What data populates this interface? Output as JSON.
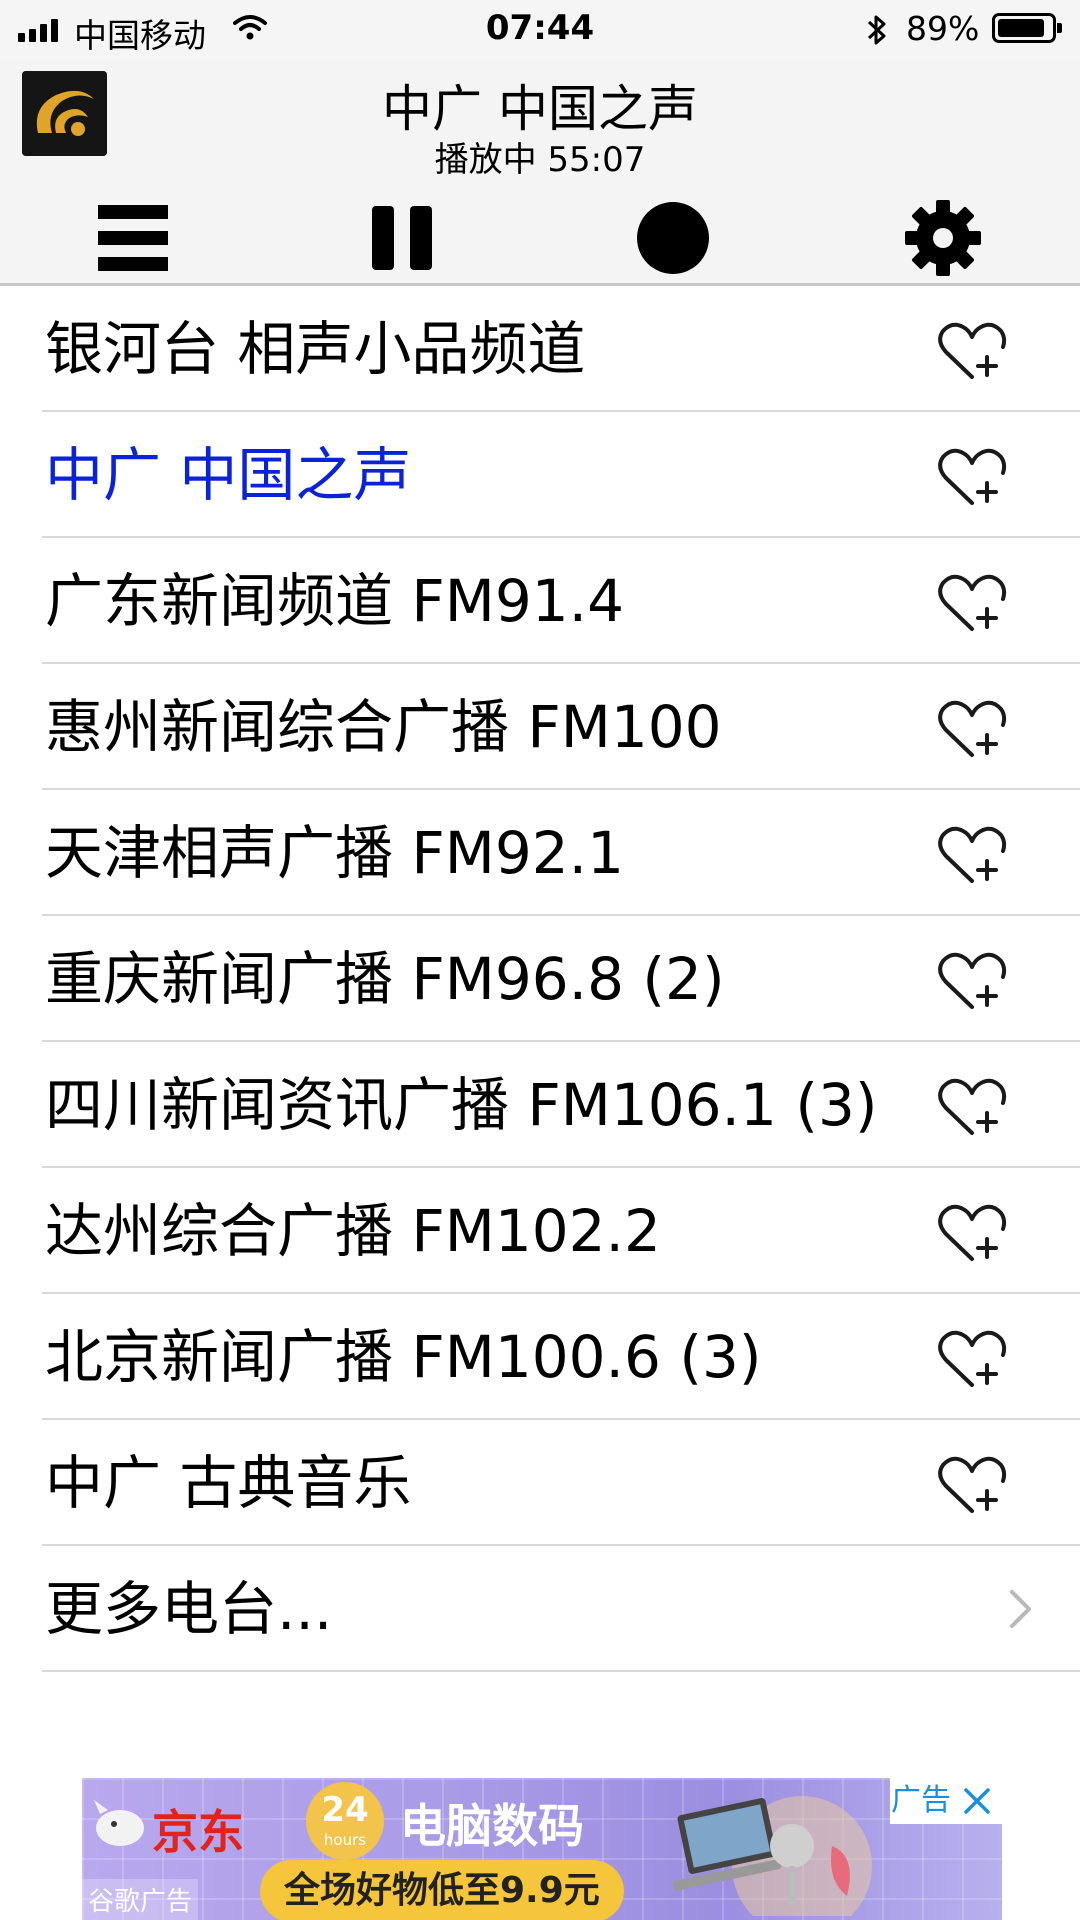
{
  "status_bar": {
    "carrier": "中国移动",
    "time": "07:44",
    "battery_percent": "89%",
    "battery_level": 0.89
  },
  "now_playing": {
    "title": "中广 中国之声",
    "status": "播放中 55:07"
  },
  "controls": [
    "menu-icon",
    "pause-icon",
    "record-icon",
    "gear-icon"
  ],
  "stations": [
    {
      "name": "银河台 相声小品频道",
      "active": false
    },
    {
      "name": "中广 中国之声",
      "active": true
    },
    {
      "name": "广东新闻频道 FM91.4",
      "active": false
    },
    {
      "name": "惠州新闻综合广播 FM100",
      "active": false
    },
    {
      "name": "天津相声广播 FM92.1",
      "active": false
    },
    {
      "name": "重庆新闻广播 FM96.8 (2)",
      "active": false
    },
    {
      "name": "四川新闻资讯广播 FM106.1 (3)",
      "active": false
    },
    {
      "name": "达州综合广播 FM102.2",
      "active": false
    },
    {
      "name": "北京新闻广播 FM100.6 (3)",
      "active": false
    },
    {
      "name": "中广 古典音乐",
      "active": false
    }
  ],
  "more_stations": "更多电台...",
  "ad": {
    "brand": "京东",
    "badge_number": "24",
    "badge_unit": "hours",
    "headline": "电脑数码",
    "promo": "全场好物低至9.9元",
    "source": "谷歌广告",
    "label": "广告"
  },
  "colors": {
    "active_station": "#0a22d8",
    "header_bg": "#f4f4f4",
    "logo_gold": "#e0a42a"
  }
}
